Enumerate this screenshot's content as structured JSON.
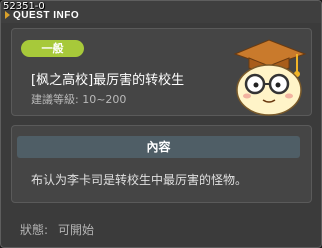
{
  "window": {
    "quest_id": "52351-0",
    "title": "QUEST INFO"
  },
  "quest": {
    "category": "一般",
    "name": "[枫之高校]最厉害的转校生",
    "level_range": "建議等級: 10~200",
    "mascot_icon": "graduation-mascot-icon"
  },
  "details": {
    "header": "內容",
    "description": "布认为李卡司是转校生中最厉害的怪物。"
  },
  "status": {
    "label": "狀態:",
    "value": "可開始"
  },
  "colors": {
    "badge": "#a7c93a",
    "section_header": "#4f5e66",
    "panel": "#454545"
  }
}
